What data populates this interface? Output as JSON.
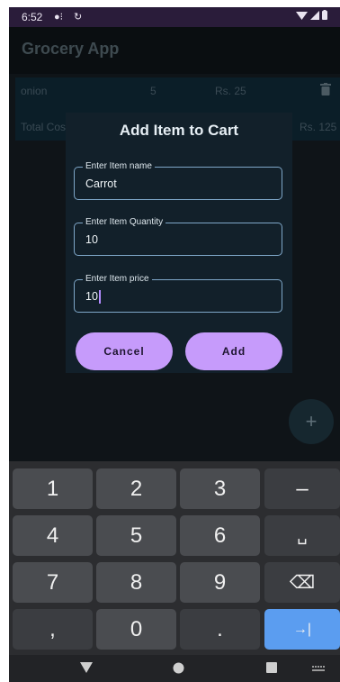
{
  "status_bar": {
    "time": "6:52"
  },
  "app_bar": {
    "title": "Grocery App"
  },
  "cart": {
    "item": {
      "name": "onion",
      "quantity": "5",
      "price": "Rs. 25"
    },
    "total": {
      "label": "Total Cos",
      "value": "Rs. 125"
    }
  },
  "dialog": {
    "title": "Add Item to Cart",
    "fields": [
      {
        "label": "Enter Item name",
        "value": "Carrot"
      },
      {
        "label": "Enter Item Quantity",
        "value": "10"
      },
      {
        "label": "Enter Item price",
        "value": "10"
      }
    ],
    "cancel_label": "Cancel",
    "add_label": "Add"
  },
  "fab": {
    "icon": "plus-icon",
    "label": "+"
  },
  "keyboard": {
    "keys": [
      "1",
      "2",
      "3",
      "–",
      "4",
      "5",
      "6",
      "␣",
      "7",
      "8",
      "9",
      "⌫",
      ",",
      "0",
      ".",
      "→|"
    ]
  },
  "colors": {
    "accent": "#c69bfb",
    "enter_key": "#5b9df0",
    "dialog_bg": "#12202a"
  }
}
